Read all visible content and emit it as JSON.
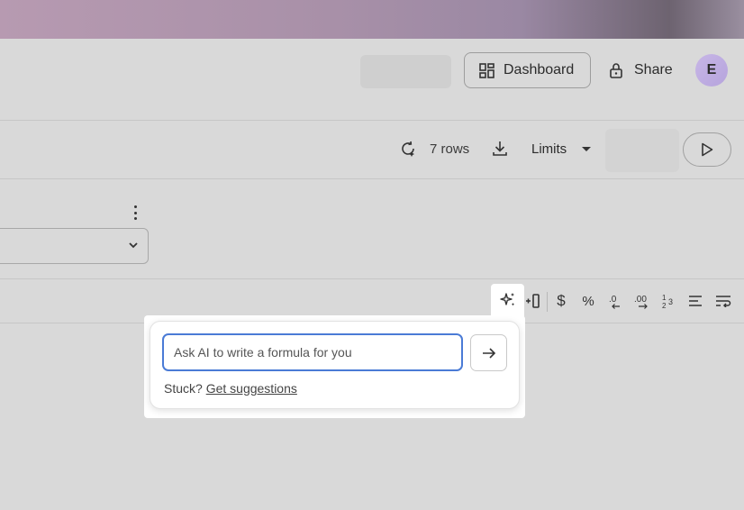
{
  "header": {
    "dashboard_label": "Dashboard",
    "share_label": "Share",
    "avatar_initial": "E"
  },
  "toolbar": {
    "rows_label": "7 rows",
    "limits_label": "Limits"
  },
  "format_bar": {
    "items": [
      {
        "icon": "ai-sparkle-icon"
      },
      {
        "icon": "insert-column-icon"
      },
      {
        "icon": "currency-icon",
        "glyph": "$"
      },
      {
        "icon": "percent-icon",
        "glyph": "%"
      },
      {
        "icon": "decrease-decimal-icon",
        "glyph": ".0"
      },
      {
        "icon": "increase-decimal-icon",
        "glyph": ".00"
      },
      {
        "icon": "fraction-icon",
        "glyph": "1/23"
      },
      {
        "icon": "align-left-icon"
      },
      {
        "icon": "wrap-text-icon"
      }
    ]
  },
  "ai_popup": {
    "input_value": "",
    "input_placeholder": "Ask AI to write a formula for you",
    "stuck_label": "Stuck?",
    "suggestions_link": "Get suggestions"
  },
  "colors": {
    "accent": "#4a7bd6",
    "overlay": "#d9d9d9",
    "avatar": "#c7b6e6"
  }
}
